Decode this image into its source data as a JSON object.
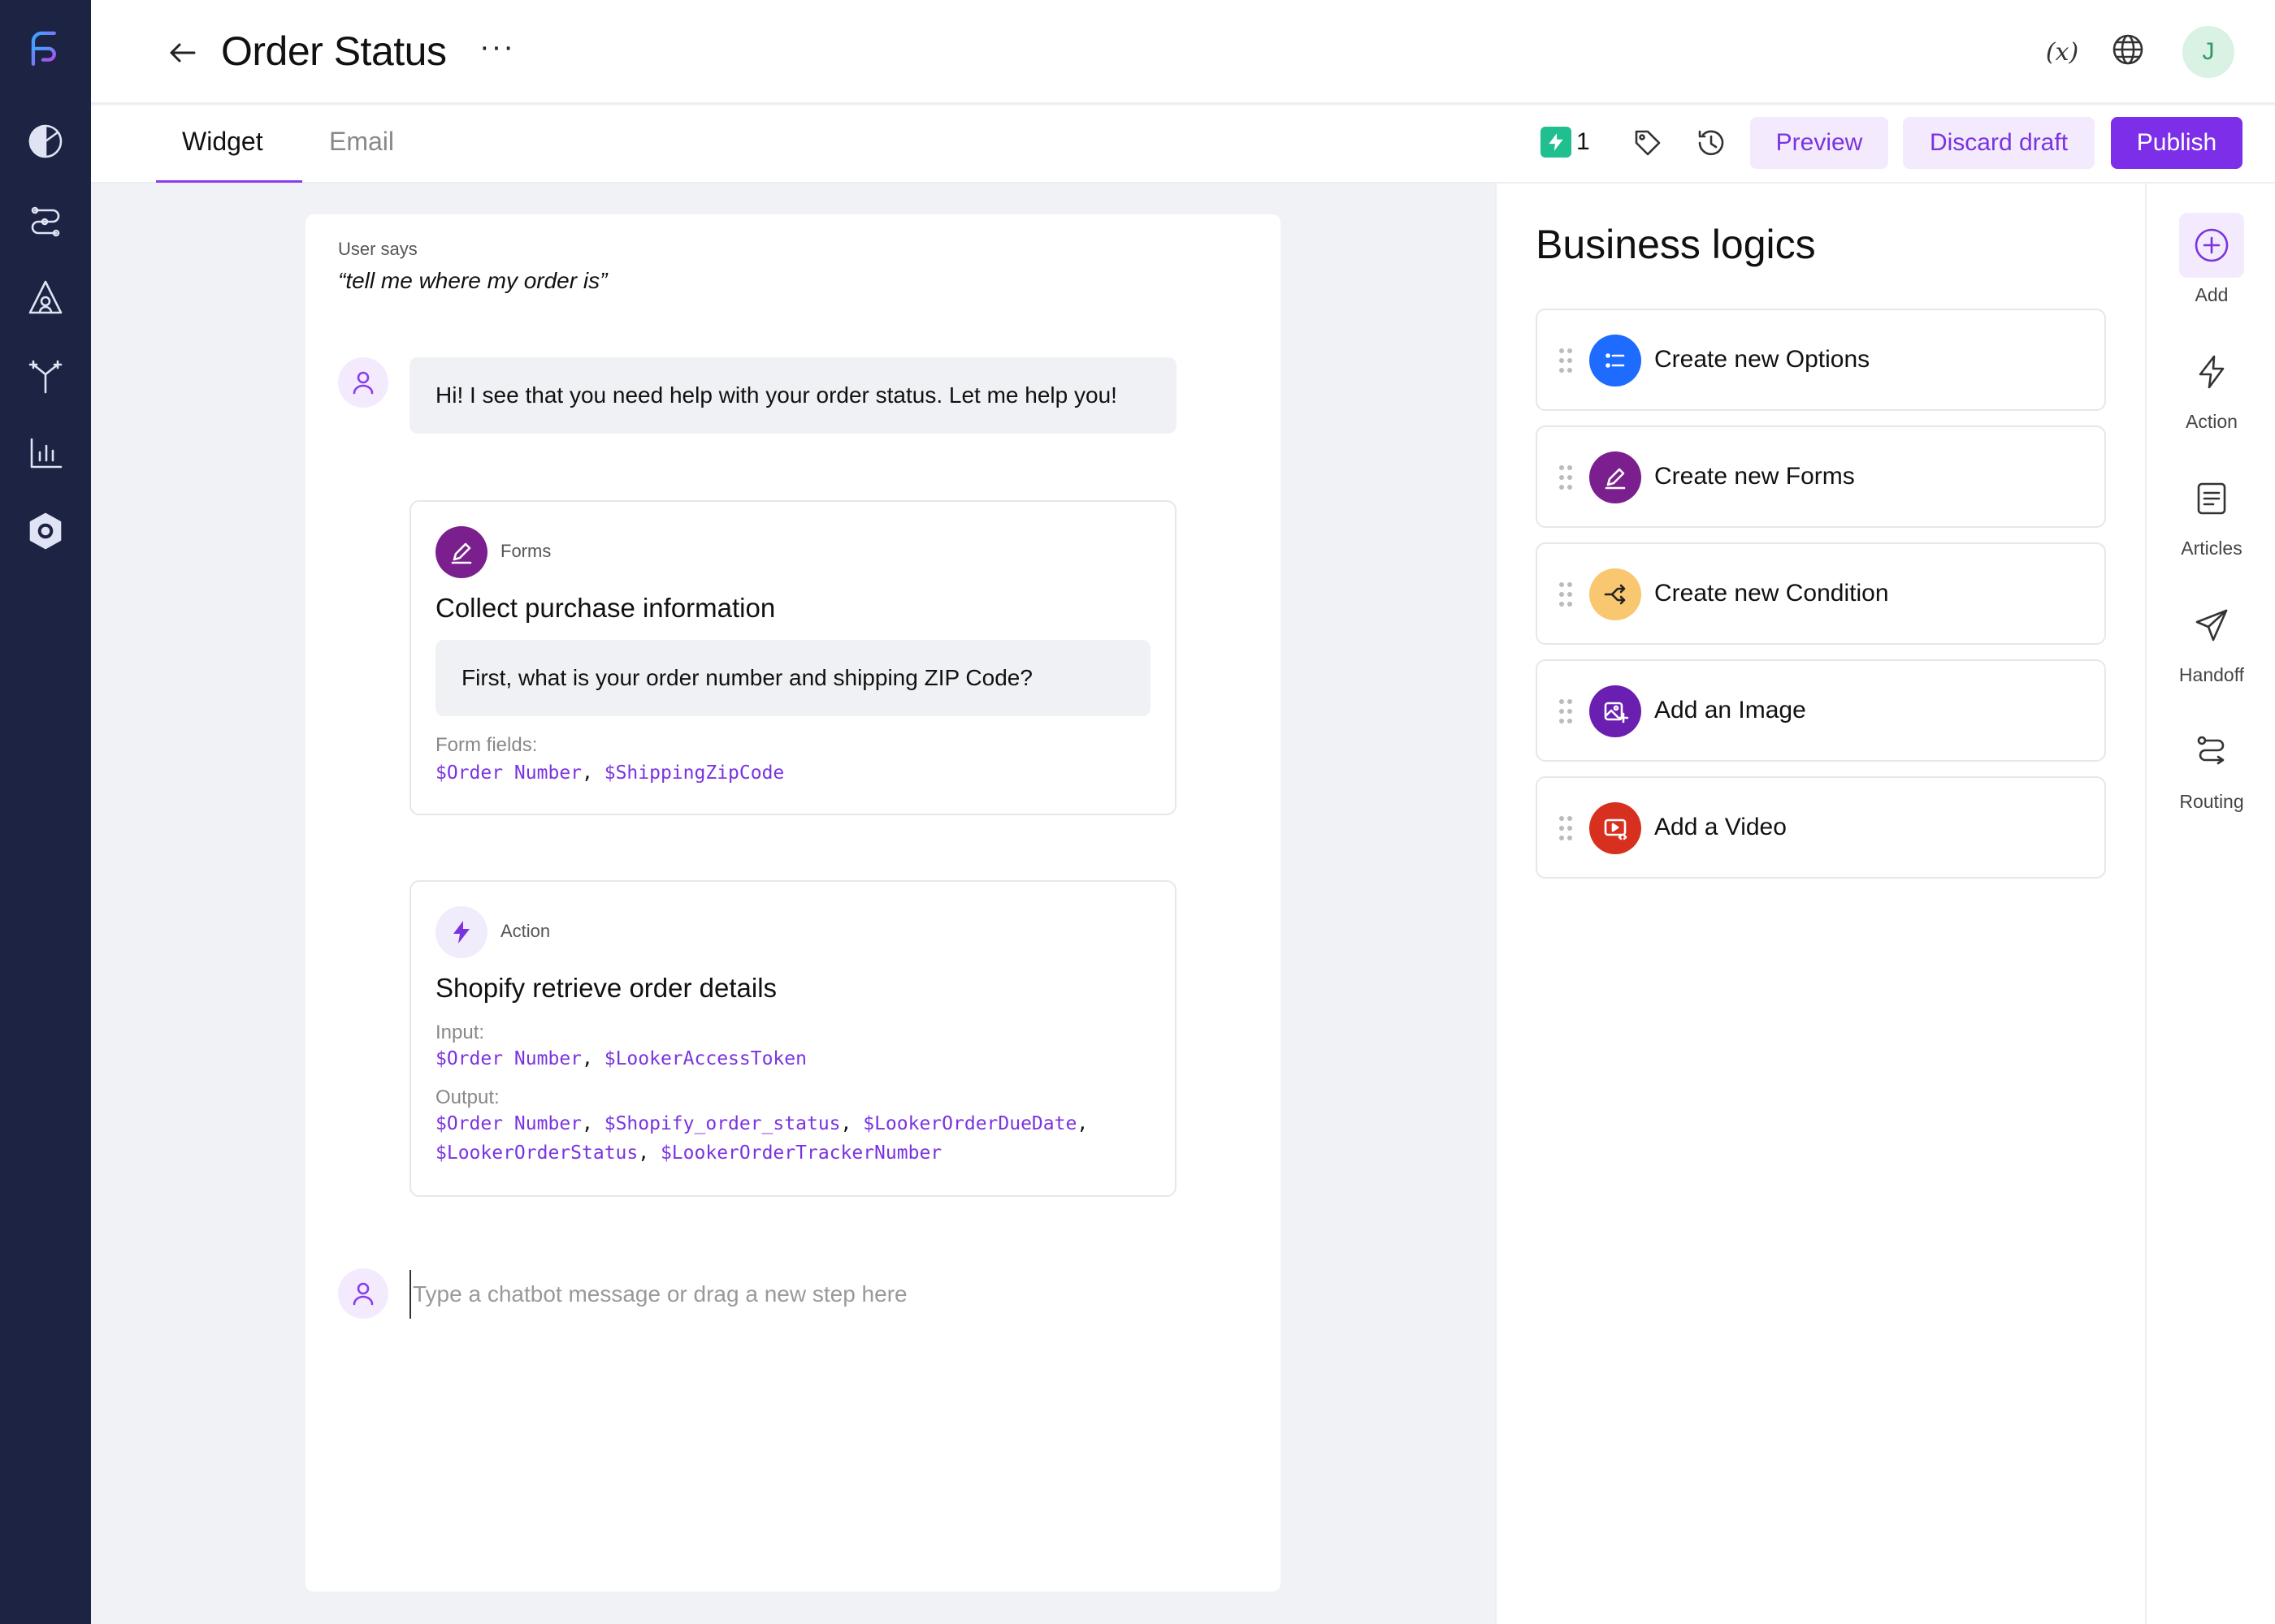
{
  "header": {
    "title": "Order Status",
    "more": "···",
    "variables": "(x)",
    "avatar_initial": "J"
  },
  "tabs": [
    {
      "label": "Widget",
      "active": true
    },
    {
      "label": "Email",
      "active": false
    }
  ],
  "toolbar": {
    "action_count": "1",
    "preview_label": "Preview",
    "discard_label": "Discard draft",
    "publish_label": "Publish"
  },
  "canvas": {
    "user_says_label": "User says",
    "user_says_text": "“tell me where my order is”",
    "bot_message": "Hi! I see that you need help with your order status. Let me help you!",
    "forms_step": {
      "type": "Forms",
      "title": "Collect purchase information",
      "question": "First, what is your order number and shipping ZIP Code?",
      "fields_label": "Form fields:",
      "fields": [
        "$Order Number",
        "$ShippingZipCode"
      ]
    },
    "action_step": {
      "type": "Action",
      "title": "Shopify retrieve order details",
      "input_label": "Input:",
      "inputs": [
        "$Order Number",
        "$LookerAccessToken"
      ],
      "output_label": "Output:",
      "outputs_line1": [
        "$Order Number",
        "$Shopify_order_status",
        "$LookerOrderDueDate"
      ],
      "outputs_line2": [
        "$LookerOrderStatus",
        "$LookerOrderTrackerNumber"
      ]
    },
    "input_placeholder": "Type a  chatbot message or drag a new step here"
  },
  "panel": {
    "title": "Business logics",
    "items": [
      {
        "label": "Create new Options",
        "icon": "list-icon",
        "color": "#1e6bff"
      },
      {
        "label": "Create new Forms",
        "icon": "pencil-icon",
        "color": "#7b1f8f"
      },
      {
        "label": "Create new Condition",
        "icon": "shuffle-icon",
        "color": "#f9c76f"
      },
      {
        "label": "Add an Image",
        "icon": "image-add-icon",
        "color": "#6a1fb0"
      },
      {
        "label": "Add a Video",
        "icon": "video-icon",
        "color": "#d8301f"
      }
    ]
  },
  "rail": [
    {
      "label": "Add",
      "icon": "plus-circle-icon"
    },
    {
      "label": "Action",
      "icon": "bolt-icon"
    },
    {
      "label": "Articles",
      "icon": "document-icon"
    },
    {
      "label": "Handoff",
      "icon": "send-icon"
    },
    {
      "label": "Routing",
      "icon": "route-icon"
    }
  ],
  "colors": {
    "accent": "#7c2ee9",
    "nav_bg": "#1c2343",
    "accent_soft": "#f3ebfd"
  }
}
